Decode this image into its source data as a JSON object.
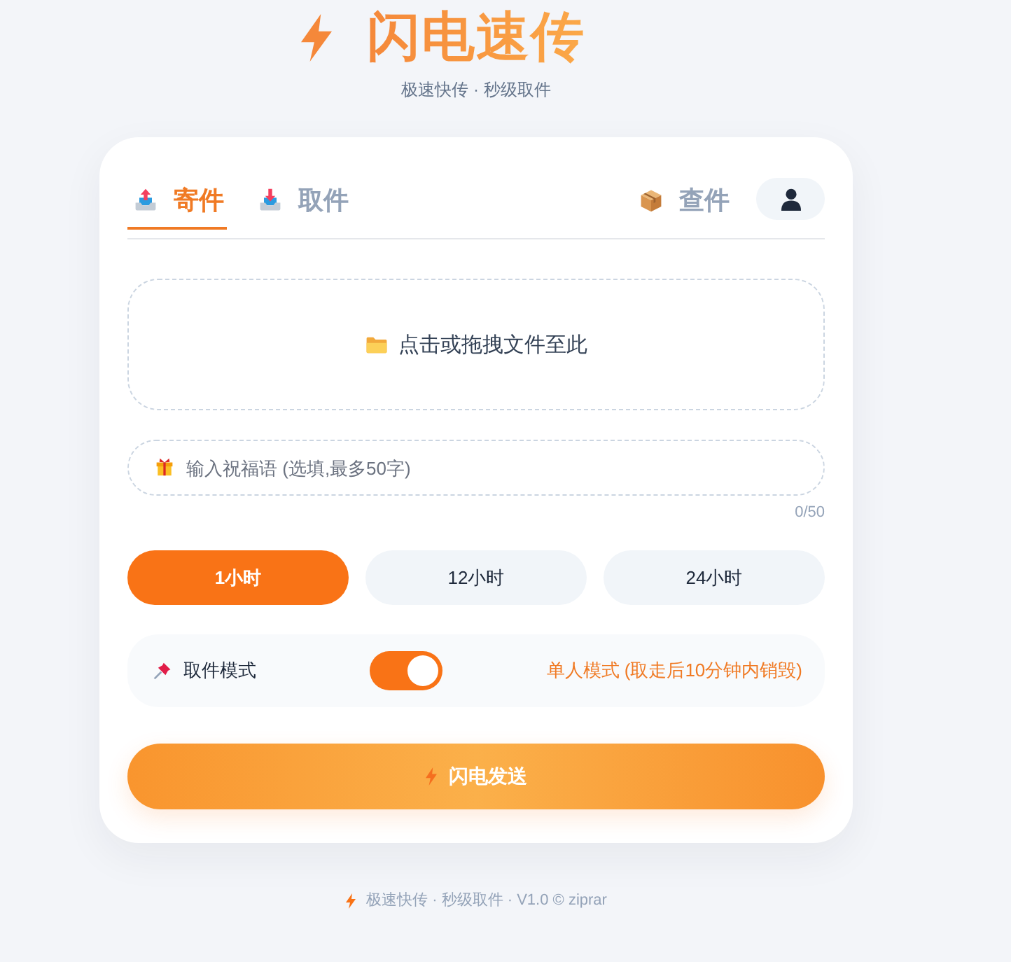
{
  "header": {
    "title": "闪电速传",
    "subtitle": "极速快传 · 秒级取件"
  },
  "tabs": [
    {
      "label": "寄件",
      "selected": true,
      "kind": "send"
    },
    {
      "label": "取件",
      "selected": false,
      "kind": "receive"
    }
  ],
  "lookup": {
    "label": "查件"
  },
  "upload": {
    "text": "点击或拖拽文件至此"
  },
  "message": {
    "placeholder": "输入祝福语 (选填,最多50字)",
    "counter": "0/50"
  },
  "durations": [
    {
      "label": "1小时",
      "selected": true
    },
    {
      "label": "12小时",
      "selected": false
    },
    {
      "label": "24小时",
      "selected": false
    }
  ],
  "mode": {
    "label": "取件模式",
    "on": true,
    "description": "单人模式 (取走后10分钟内销毁)"
  },
  "send_button": {
    "label": "闪电发送"
  },
  "footer": {
    "text": "极速快传 · 秒级取件 · V1.0 © ziprar"
  }
}
